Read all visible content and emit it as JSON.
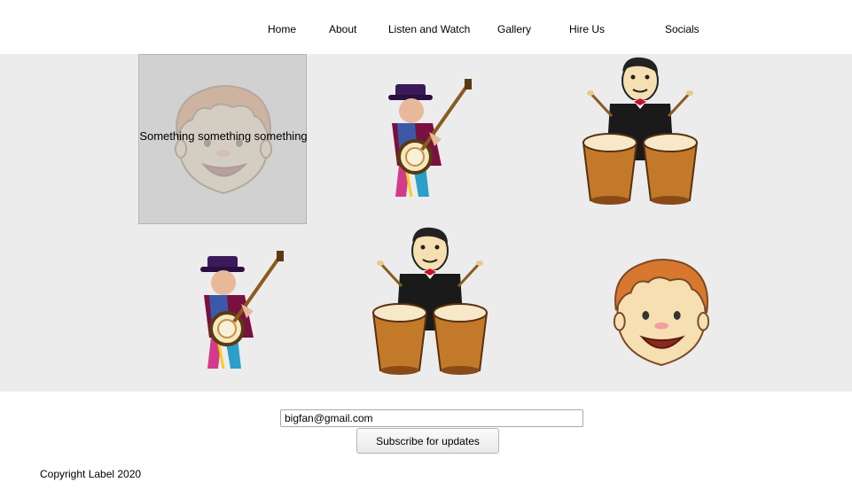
{
  "nav": {
    "items": [
      {
        "label": "Home"
      },
      {
        "label": "About"
      },
      {
        "label": "Listen and Watch"
      },
      {
        "label": "Gallery"
      },
      {
        "label": "Hire Us"
      },
      {
        "label": "Socials"
      }
    ]
  },
  "gallery": {
    "overlay_text": "Something something something",
    "tiles": [
      {
        "image": "boy-face-illustration"
      },
      {
        "image": "banjo-player-illustration"
      },
      {
        "image": "bongo-drummer-illustration"
      },
      {
        "image": "banjo-player-illustration"
      },
      {
        "image": "bongo-drummer-illustration"
      },
      {
        "image": "boy-face-illustration"
      }
    ]
  },
  "subscribe": {
    "email_value": "bigfan@gmail.com",
    "button_label": "Subscribe for updates"
  },
  "footer": {
    "copyright": "Copyright Label 2020"
  },
  "colors": {
    "gallery_bg": "#ececec",
    "overlay": "#c8c8c8"
  }
}
